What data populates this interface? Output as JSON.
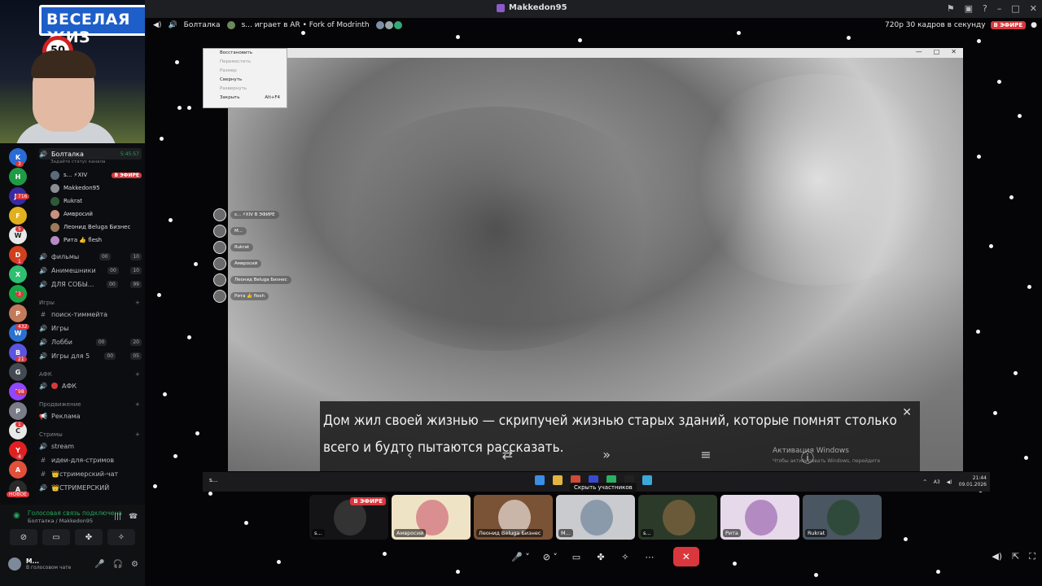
{
  "window": {
    "title": "Makkedon95"
  },
  "stream_header": {
    "channel": "Болталка",
    "activity": "s... играет в AR • Fork of Modrinth",
    "quality": "720p 30 кадров в секунду",
    "live": "В ЭФИРЕ"
  },
  "webcam": {
    "sign_text": "ВЕСЕЛАЯ ЖИЗ",
    "speed_sign": "50"
  },
  "rail": {
    "icons": [
      {
        "label": "K",
        "color": "#2b6bd6"
      },
      {
        "label": "H",
        "color": "#1f9b45"
      },
      {
        "label": "JB",
        "color": "#3a2aa0"
      },
      {
        "label": "F",
        "color": "#e0b020"
      },
      {
        "label": "W",
        "color": "#e8e8e8"
      },
      {
        "label": "D",
        "color": "#d0401d"
      },
      {
        "label": "X",
        "color": "#2fbf71"
      },
      {
        "label": "K",
        "color": "#18a545"
      },
      {
        "label": "P",
        "color": "#c47a5a"
      },
      {
        "label": "W",
        "color": "#2a71d0"
      },
      {
        "label": "B",
        "color": "#5a54e0"
      },
      {
        "label": "G",
        "color": "#444a52"
      },
      {
        "label": "T",
        "color": "#9146ff"
      },
      {
        "label": "P",
        "color": "#7a7d88"
      },
      {
        "label": "C",
        "color": "#e8e8e8"
      },
      {
        "label": "Y",
        "color": "#e02020"
      },
      {
        "label": "A",
        "color": "#e0503a"
      },
      {
        "label": "A",
        "color": "#2a2a2a"
      }
    ],
    "badges": [
      "3",
      "716",
      "5",
      "1",
      "3",
      "432",
      "21",
      "98",
      "1",
      "4"
    ],
    "new_badge": "НОВОЕ"
  },
  "channels": {
    "voice_active": "Болталка",
    "voice_active_time": "5:45:57",
    "voice_status_hint": "Задайте статус канала",
    "users": [
      {
        "name": "s... ⚡XIV",
        "live": "В ЭФИРЕ"
      },
      {
        "name": "Makkedon95",
        "live": ""
      },
      {
        "name": "Rukrat",
        "live": ""
      },
      {
        "name": "Амвросий",
        "live": ""
      },
      {
        "name": "Леонид Beluga Бизнес",
        "live": ""
      },
      {
        "name": "Рита 👍 flesh",
        "live": ""
      }
    ],
    "voice_list": [
      {
        "name": "фильмы",
        "num1": "00",
        "num2": "10"
      },
      {
        "name": "Анимешники",
        "num1": "00",
        "num2": "10"
      },
      {
        "name": "ДЛЯ СОБЫ...",
        "num1": "00",
        "num2": "99"
      }
    ],
    "cat_games": "Игры",
    "games_list": [
      {
        "sym": "#",
        "name": "поиск-тиммейта",
        "num1": "",
        "num2": ""
      },
      {
        "sym": "🔊",
        "name": "Игры",
        "num1": "",
        "num2": ""
      },
      {
        "sym": "🔊",
        "name": "Лобби",
        "num1": "00",
        "num2": "20"
      },
      {
        "sym": "🔊",
        "name": "Игры для 5",
        "num1": "00",
        "num2": "05"
      }
    ],
    "cat_afk": "АФК",
    "afk": "АФК",
    "cat_promo": "Продвижение",
    "promo": "Реклама",
    "cat_streams": "Стримы",
    "streams_list": [
      {
        "sym": "🔊",
        "name": "stream"
      },
      {
        "sym": "#",
        "name": "идеи-для-стримов"
      },
      {
        "sym": "#",
        "name": "👑стримерский-чат"
      },
      {
        "sym": "🔊",
        "name": "👑СТРИМЕРСКИЙ"
      }
    ]
  },
  "voice_panel": {
    "connected": "Голосовая связь подключена",
    "location": "Болталка / Makkedon95",
    "user": "M...",
    "user_status": "В голосовом чате"
  },
  "context_menu": [
    {
      "label": "Восстановить",
      "shortcut": "",
      "disabled": false
    },
    {
      "label": "Переместить",
      "shortcut": "",
      "disabled": true
    },
    {
      "label": "Размер",
      "shortcut": "",
      "disabled": true
    },
    {
      "label": "Свернуть",
      "shortcut": "",
      "disabled": false
    },
    {
      "label": "Развернуть",
      "shortcut": "",
      "disabled": true
    },
    {
      "label": "Закрыть",
      "shortcut": "Alt+F4",
      "disabled": false
    }
  ],
  "overlay_users": [
    "s... ⚡XIV  В ЭФИРЕ",
    "M...",
    "Rukrat",
    "Амвросий",
    "Леонид Beluga Бизнес",
    "Рита 👍 flesh"
  ],
  "game": {
    "dialog_text": "Дом жил своей жизнью — скрипучей жизнью старых зданий, которые помнят столько всего и будто пытаются рассказать.",
    "watermark_title": "Активация Windows",
    "watermark_sub": "Чтобы активировать Windows, перейдите"
  },
  "taskbar": {
    "left_label": "s...",
    "tooltip": "Скрыть участников",
    "lang": "A3",
    "time": "21:44",
    "date": "09.01.2026"
  },
  "tiles": [
    {
      "label": "s...",
      "live": "В ЭФИРЕ",
      "bg": "#141416",
      "art": "#333"
    },
    {
      "label": "Амвросий",
      "live": "",
      "bg": "#efe3c6",
      "art": "#d98f8f"
    },
    {
      "label": "Леонид Beluga Бизнес",
      "live": "",
      "bg": "#7a5236",
      "art": "#c9b6a8"
    },
    {
      "label": "M...",
      "live": "",
      "bg": "#c9cbcf",
      "art": "#8a9aab"
    },
    {
      "label": "s...",
      "live": "",
      "bg": "#2c3a2a",
      "art": "#6b5a3a"
    },
    {
      "label": "Рита",
      "live": "",
      "bg": "#e6d9ea",
      "art": "#b48ac2"
    },
    {
      "label": "Rukrat",
      "live": "",
      "bg": "#4a5661",
      "art": "#2f4a3a"
    }
  ]
}
